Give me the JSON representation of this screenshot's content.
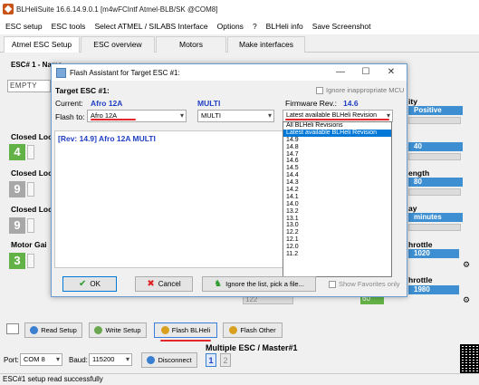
{
  "window": {
    "title": "BLHeliSuite 16.6.14.9.0.1  [m4wFCIntf Atmel-BLB/SK @COM8]"
  },
  "menu": [
    "ESC setup",
    "ESC tools",
    "Select ATMEL / SILABS Interface",
    "Options",
    "?",
    "BLHeli info",
    "Save Screenshot"
  ],
  "tabs": [
    "Atmel ESC Setup",
    "ESC overview",
    "Motors",
    "Make interfaces"
  ],
  "main": {
    "esc_label": "ESC# 1 - Name",
    "empty_value": "EMPTY",
    "left_labels": [
      "Closed Loo",
      "Closed Loo",
      "Closed Loo",
      "Motor Gai"
    ],
    "left_numbers": [
      "4",
      "9",
      "9",
      "3"
    ],
    "right_labels": [
      "ity",
      "ength",
      "ay",
      "hrottle",
      "hrottle"
    ],
    "right_values": [
      "Positive",
      "40",
      "80",
      "minutes",
      "1020",
      "1980"
    ],
    "slider_values": [
      "122",
      "60"
    ]
  },
  "dialog": {
    "title": "Flash Assistant for Target ESC #1:",
    "target_label": "Target ESC #1:",
    "current_label": "Current:",
    "current_value": "Afro 12A",
    "multi_value": "MULTI",
    "firmware_label": "Firmware Rev.:",
    "firmware_value": "14.6",
    "ignore_label": "Ignore inappropriate MCU",
    "flash_to_label": "Flash to:",
    "flash_to_value": "Afro 12A",
    "flash_to_multi": "MULTI",
    "revision_combo": "Latest available BLHeli Revision",
    "info_text": "[Rev: 14.9] Afro 12A MULTI",
    "revisions": [
      "All BLHeli Revisions",
      "Latest available BLHeli Revision",
      "14.9",
      "14.8",
      "14.7",
      "14.6",
      "14.5",
      "14.4",
      "14.3",
      "14.2",
      "14.1",
      "14.0",
      "13.2",
      "13.1",
      "13.0",
      "12.2",
      "12.1",
      "12.0",
      "11.2"
    ],
    "selected_revision_index": 1,
    "ok_label": "OK",
    "cancel_label": "Cancel",
    "ignore_list_label": "Ignore the list, pick a file...",
    "show_favorites_label": "Show Favorites only",
    "accent_red": "#e5262a",
    "accent_blue": "#1f3fc4"
  },
  "bottom": {
    "read_setup": "Read Setup",
    "write_setup": "Write Setup",
    "flash_blheli": "Flash BLHeli",
    "flash_other": "Flash Other",
    "multiple_esc": "Multiple ESC / Master#1",
    "port_label": "Port:",
    "port_value": "COM 8",
    "baud_label": "Baud:",
    "baud_value": "115200",
    "disconnect": "Disconnect",
    "esc_buttons": [
      "1",
      "2"
    ]
  },
  "status": {
    "text": "ESC#1 setup read successfully"
  }
}
